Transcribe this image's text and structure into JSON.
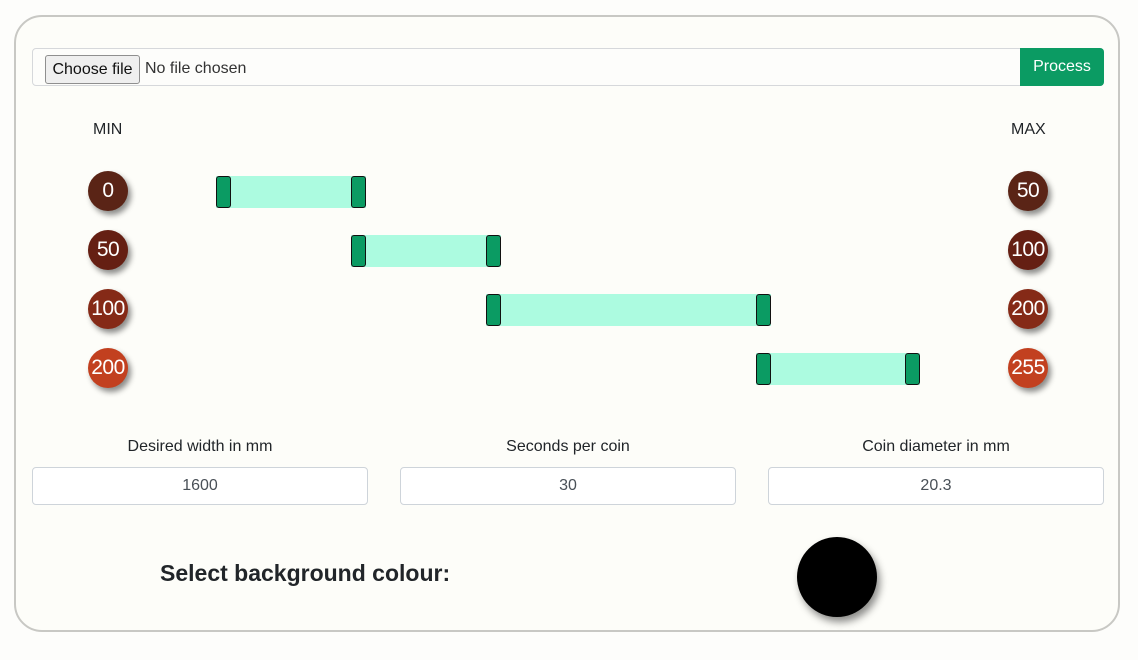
{
  "upload": {
    "choose_label": "Choose file",
    "status": "No file chosen",
    "process_label": "Process"
  },
  "range": {
    "min_label": "MIN",
    "max_label": "MAX",
    "scale_max": 255,
    "rows": [
      {
        "min": "0",
        "max": "50",
        "low": 0,
        "high": 50,
        "min_color": "#5a2416",
        "max_color": "#5a2416"
      },
      {
        "min": "50",
        "max": "100",
        "low": 50,
        "high": 100,
        "min_color": "#651f13",
        "max_color": "#651f13"
      },
      {
        "min": "100",
        "max": "200",
        "low": 100,
        "high": 200,
        "min_color": "#852a17",
        "max_color": "#852a17"
      },
      {
        "min": "200",
        "max": "255",
        "low": 200,
        "high": 255,
        "min_color": "#c2401f",
        "max_color": "#c2401f"
      }
    ],
    "accent_color": "#0b9b63",
    "fill_color": "#acfbe0"
  },
  "fields": {
    "width": {
      "label": "Desired width in mm",
      "value": "1600"
    },
    "seconds": {
      "label": "Seconds per coin",
      "value": "30"
    },
    "diameter": {
      "label": "Coin diameter in mm",
      "value": "20.3"
    }
  },
  "background": {
    "label": "Select background colour:",
    "color": "#000000"
  }
}
